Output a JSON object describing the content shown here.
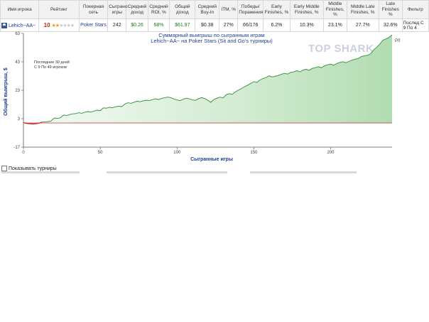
{
  "table": {
    "headers": [
      "Имя игрока",
      "Рейтинг",
      "Покерная сеть",
      "Сыграно игры",
      "Средний доход",
      "Средний ROI, %",
      "Общий доход",
      "Средний Buy-In",
      "ITM, %",
      "Победы/ Поражения",
      "Early Finishes, %",
      "Early Middle Finishes, %",
      "Middle Finishes, %",
      "Middle Late Finishes, %",
      "Late Finishes %",
      "Фильтр"
    ],
    "row": {
      "player": "Lehich~AA~",
      "rating": "10",
      "stars_filled": 2,
      "stars_total": 6,
      "network": "Poker Stars",
      "games": "242",
      "avg_profit": "$0.26",
      "avg_roi": "68%",
      "total_profit": "$61.97",
      "avg_buyin": "$0.38",
      "itm": "27%",
      "wins_losses": "66/176",
      "early": "6.2%",
      "early_middle": "10.3%",
      "middle": "23.1%",
      "middle_late": "27.7%",
      "late": "32.6%",
      "filter": "Послед С 9 По 4"
    }
  },
  "watermark": "TOP SHARK",
  "show_tournaments_label": "Показывать турниры",
  "chart_data": {
    "type": "area",
    "title": "Суммарный выигрыш по сыгранным играм",
    "subtitle": "Lehich~AA~ на Poker Stars (Sit and Go's турниры)",
    "xlabel": "Сыгранные игры",
    "ylabel": "Общий выигрыш, $",
    "xlim": [
      0,
      240
    ],
    "ylim": [
      -17,
      63
    ],
    "xticks": [
      0,
      50,
      100,
      150,
      200
    ],
    "yticks": [
      -17,
      3,
      23,
      43,
      63
    ],
    "baseline": 0,
    "note_lines": [
      "Последние 30 дней",
      "С 9 По 49 игроков"
    ],
    "corner_label": "РЛ",
    "grid": false,
    "colors": {
      "line": "#2f8f35",
      "fill": "#d8eed8",
      "fill_end": "#a8d8a8",
      "baseline": "#c03030",
      "negative": "#d02020"
    },
    "series": [
      {
        "x": [
          0,
          2,
          4,
          6,
          8,
          10,
          12,
          14,
          16,
          18,
          20,
          22,
          24,
          26,
          28,
          30,
          32,
          34,
          36,
          38,
          40,
          42,
          44,
          46,
          48,
          50,
          52,
          54,
          56,
          58,
          60,
          62,
          64,
          66,
          68,
          70,
          72,
          74,
          76,
          78,
          80,
          82,
          84,
          86,
          88,
          90,
          92,
          94,
          96,
          98,
          100,
          102,
          104,
          106,
          108,
          110,
          112,
          114,
          116,
          118,
          120,
          122,
          124,
          126,
          128,
          130,
          132,
          134,
          136,
          138,
          140,
          142,
          144,
          146,
          148,
          150,
          152,
          154,
          156,
          158,
          160,
          162,
          164,
          166,
          168,
          170,
          172,
          174,
          176,
          178,
          180,
          182,
          184,
          186,
          188,
          190,
          192,
          194,
          196,
          198,
          200,
          202,
          204,
          206,
          208,
          210,
          212,
          214,
          216,
          218,
          220,
          222,
          224,
          226,
          228,
          230,
          232,
          234,
          236,
          238,
          240
        ],
        "y": [
          0.3,
          -0.3,
          -0.5,
          -0.7,
          -0.5,
          -0.2,
          0.6,
          0.8,
          1.0,
          1.4,
          3.5,
          3.2,
          3.6,
          5.5,
          5.3,
          5.9,
          6.4,
          6.6,
          7.2,
          6.8,
          7.6,
          8.0,
          7.7,
          8.4,
          9.0,
          8.7,
          10.6,
          10.4,
          11.0,
          10.7,
          11.4,
          11.8,
          11.5,
          13.3,
          14.2,
          13.8,
          14.6,
          15.3,
          14.9,
          15.6,
          16.0,
          15.7,
          16.4,
          17.0,
          16.5,
          17.3,
          17.8,
          18.2,
          17.8,
          16.9,
          16.2,
          15.7,
          16.8,
          17.4,
          17.0,
          16.2,
          15.9,
          17.1,
          17.8,
          17.2,
          16.0,
          14.5,
          16.6,
          17.4,
          18.2,
          17.6,
          19.9,
          20.6,
          20.2,
          21.9,
          23.2,
          24.3,
          25.5,
          26.6,
          27.8,
          29.1,
          28.6,
          30.2,
          31.3,
          32.0,
          33.2,
          32.4,
          32.9,
          33.4,
          34.3,
          34.9,
          34.4,
          35.6,
          35.9,
          36.8,
          36.0,
          37.2,
          37.8,
          37.0,
          38.4,
          38.9,
          39.6,
          38.9,
          40.2,
          40.9,
          41.4,
          40.7,
          41.8,
          42.6,
          43.1,
          42.4,
          43.3,
          44.3,
          44.9,
          45.4,
          46.8,
          47.2,
          47.6,
          48.6,
          51.4,
          53.2,
          55.5,
          58.2,
          59.1,
          60.2,
          61.97
        ]
      }
    ]
  }
}
